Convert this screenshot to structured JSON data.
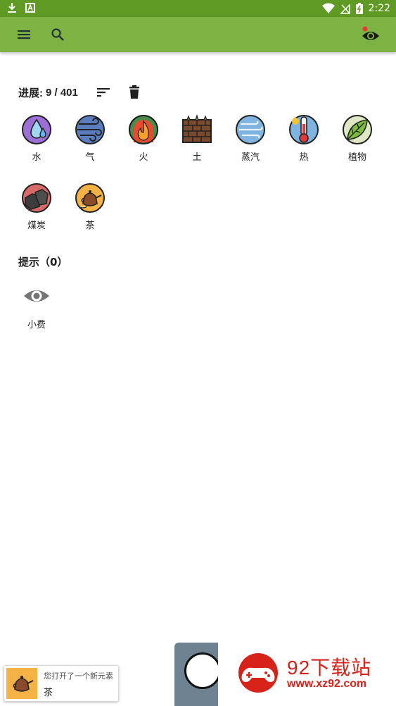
{
  "status_bar": {
    "time": "2:22"
  },
  "app_bar": {
    "menu_icon": "menu-icon",
    "search_icon": "search-icon",
    "reveal_icon": "eye-icon",
    "color": "#7cb342"
  },
  "progress": {
    "label": "进展:",
    "value": "9 / 401"
  },
  "elements": [
    {
      "name": "水",
      "icon": "water-drop-icon"
    },
    {
      "name": "气",
      "icon": "air-wind-icon"
    },
    {
      "name": "火",
      "icon": "fire-icon"
    },
    {
      "name": "土",
      "icon": "earth-soil-icon"
    },
    {
      "name": "蒸汽",
      "icon": "steam-icon"
    },
    {
      "name": "热",
      "icon": "thermometer-icon"
    },
    {
      "name": "植物",
      "icon": "leaf-icon"
    },
    {
      "name": "煤炭",
      "icon": "coal-icon"
    },
    {
      "name": "茶",
      "icon": "teapot-icon"
    }
  ],
  "hints": {
    "title": "提示（0）",
    "tip_label": "小费",
    "tip_icon": "eye-icon"
  },
  "toast": {
    "title": "您打开了一个新元素",
    "element": "茶"
  },
  "watermark": {
    "brand": "92下载站",
    "url": "www.xz92.com"
  }
}
